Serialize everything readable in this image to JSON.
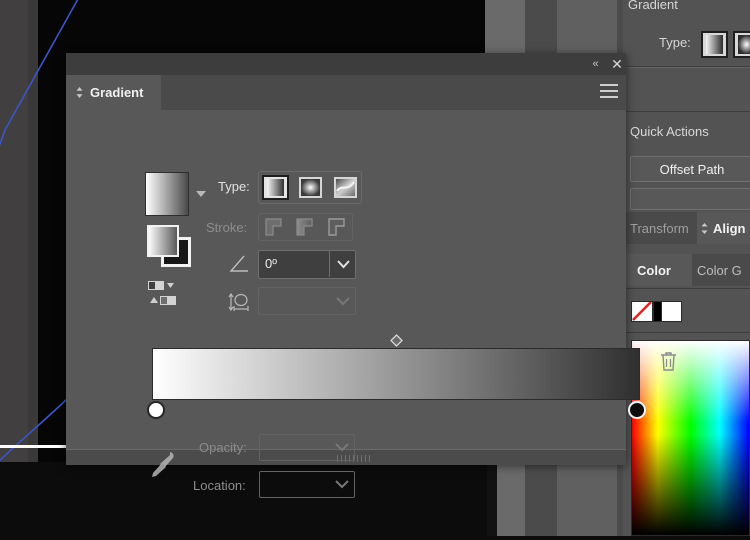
{
  "app": {
    "theme_bg": "#535353",
    "panel_bg": "#585858",
    "accent_text": "#f0f0f0"
  },
  "gradient_panel": {
    "tab_label": "Gradient",
    "collapse_label": "«",
    "close_label": "✕",
    "menu_icon": "hamburger-menu-icon",
    "type": {
      "label": "Type:",
      "options": [
        "linear-gradient",
        "radial-gradient",
        "freeform-gradient"
      ],
      "selected_index": 0
    },
    "stroke": {
      "label": "Stroke:",
      "options": [
        "stroke-within",
        "stroke-along",
        "stroke-across"
      ],
      "selected_index": -1,
      "enabled": false
    },
    "angle": {
      "icon": "angle-icon",
      "value": "0º",
      "caret": "chevron-down-icon"
    },
    "aspect_ratio": {
      "icon": "aspect-ratio-icon",
      "value": "",
      "caret": "chevron-down-icon",
      "enabled": false
    },
    "gradient_slider": {
      "midpoint_marker": "diamond-midpoint",
      "stops": [
        {
          "position": 0,
          "color": "#ffffff",
          "name": "gradient-stop-start"
        },
        {
          "position": 100,
          "color": "#0d0d0d",
          "name": "gradient-stop-end"
        }
      ],
      "bar_from": "#ffffff",
      "bar_to": "#303030"
    },
    "delete_stop_icon": "trash-icon",
    "eyedropper_icon": "eyedropper-icon",
    "opacity": {
      "label": "Opacity:",
      "value": "",
      "caret": "chevron-down-icon",
      "enabled": false
    },
    "location": {
      "label": "Location:",
      "value": "",
      "caret": "chevron-down-icon",
      "enabled": false
    },
    "swatch_preview_name": "gradient-swatch-preview",
    "swatch_dropdown_icon": "caret-down-icon",
    "fill_stroke_icon": "fill-stroke-indicator",
    "resize_grip": "panel-resize-grip"
  },
  "right_dock": {
    "gradient_section": {
      "title": "Gradient",
      "type_label": "Type:",
      "type_options": [
        "linear-gradient",
        "radial-gradient"
      ]
    },
    "quick_actions": {
      "title": "Quick Actions",
      "buttons": [
        "Offset Path",
        ""
      ]
    },
    "tabs_row_1": [
      {
        "label": "Transform",
        "active": false
      },
      {
        "label": "Align",
        "active": true
      }
    ],
    "tabs_row_2": [
      {
        "label": "Color",
        "active": true
      },
      {
        "label": "Color G",
        "active": false
      }
    ],
    "swatches": [
      {
        "name": "none-swatch",
        "color": "none"
      },
      {
        "name": "black-swatch",
        "color": "#000000"
      },
      {
        "name": "white-swatch",
        "color": "#ffffff"
      }
    ],
    "color_field_name": "color-spectrum-field"
  },
  "canvas": {
    "artboard_name": "artboard",
    "path_color": "#3a56c8",
    "background": "#0c0c0c"
  }
}
